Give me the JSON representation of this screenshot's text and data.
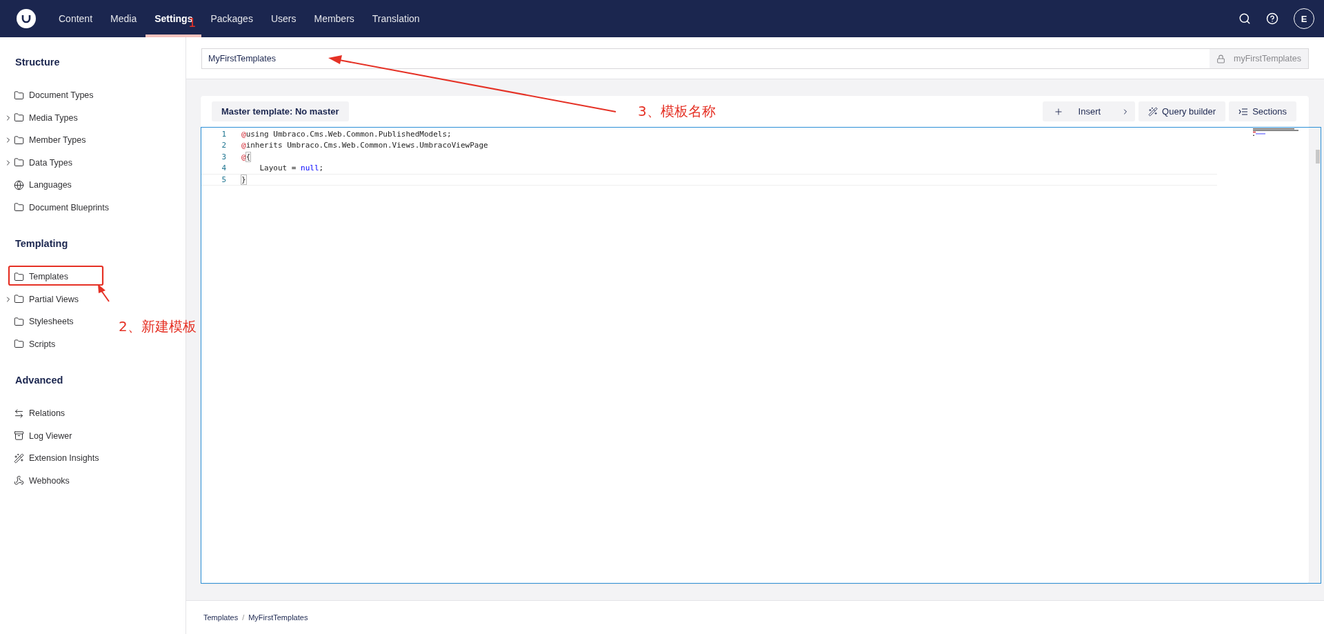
{
  "header": {
    "nav": [
      {
        "label": "Content",
        "selected": false
      },
      {
        "label": "Media",
        "selected": false
      },
      {
        "label": "Settings",
        "selected": true
      },
      {
        "label": "Packages",
        "selected": false
      },
      {
        "label": "Users",
        "selected": false
      },
      {
        "label": "Members",
        "selected": false
      },
      {
        "label": "Translation",
        "selected": false
      }
    ],
    "avatar": "E"
  },
  "sidebar": {
    "groups": [
      {
        "title": "Structure",
        "items": [
          {
            "label": "Document Types",
            "kind": "folder",
            "expandable": false
          },
          {
            "label": "Media Types",
            "kind": "folder",
            "expandable": true
          },
          {
            "label": "Member Types",
            "kind": "folder",
            "expandable": true
          },
          {
            "label": "Data Types",
            "kind": "folder",
            "expandable": true
          },
          {
            "label": "Languages",
            "kind": "globe",
            "expandable": false
          },
          {
            "label": "Document Blueprints",
            "kind": "folder",
            "expandable": false
          }
        ]
      },
      {
        "title": "Templating",
        "items": [
          {
            "label": "Templates",
            "kind": "folder",
            "expandable": false
          },
          {
            "label": "Partial Views",
            "kind": "folder",
            "expandable": true
          },
          {
            "label": "Stylesheets",
            "kind": "folder",
            "expandable": false
          },
          {
            "label": "Scripts",
            "kind": "folder",
            "expandable": false
          }
        ]
      },
      {
        "title": "Advanced",
        "items": [
          {
            "label": "Relations",
            "kind": "arrows",
            "expandable": false
          },
          {
            "label": "Log Viewer",
            "kind": "archive",
            "expandable": false
          },
          {
            "label": "Extension Insights",
            "kind": "wand",
            "expandable": false
          },
          {
            "label": "Webhooks",
            "kind": "webhook",
            "expandable": false
          }
        ]
      }
    ]
  },
  "name_field": {
    "value": "MyFirstTemplates",
    "alias": "myFirstTemplates"
  },
  "toolbar": {
    "master_template": "Master template: No master",
    "buttons": [
      {
        "kind": "insert",
        "label": "Insert"
      },
      {
        "kind": "query",
        "label": "Query builder"
      },
      {
        "kind": "sections",
        "label": "Sections"
      }
    ]
  },
  "editor": {
    "lines": [
      {
        "number": "1",
        "tokens": [
          {
            "kind": "at",
            "text": "@"
          },
          {
            "kind": "plain",
            "text": "using Umbraco.Cms.Web.Common.PublishedModels;"
          }
        ]
      },
      {
        "number": "2",
        "tokens": [
          {
            "kind": "at",
            "text": "@"
          },
          {
            "kind": "plain",
            "text": "inherits Umbraco.Cms.Web.Common.Views.UmbracoViewPage"
          }
        ]
      },
      {
        "number": "3",
        "tokens": [
          {
            "kind": "at",
            "text": "@"
          },
          {
            "kind": "brace",
            "text": "{"
          }
        ]
      },
      {
        "number": "4",
        "tokens": [
          {
            "kind": "plain",
            "text": "    Layout = "
          },
          {
            "kind": "keyword",
            "text": "null"
          },
          {
            "kind": "plain",
            "text": ";"
          }
        ]
      },
      {
        "number": "5",
        "tokens": [
          {
            "kind": "brace",
            "text": "}"
          }
        ]
      }
    ]
  },
  "breadcrumb": [
    "Templates",
    "/",
    "MyFirstTemplates"
  ],
  "annotations": [
    {
      "kind": "step",
      "text": "1"
    },
    {
      "kind": "step",
      "text": "2、新建模板"
    },
    {
      "kind": "step",
      "text": "3、模板名称"
    }
  ]
}
